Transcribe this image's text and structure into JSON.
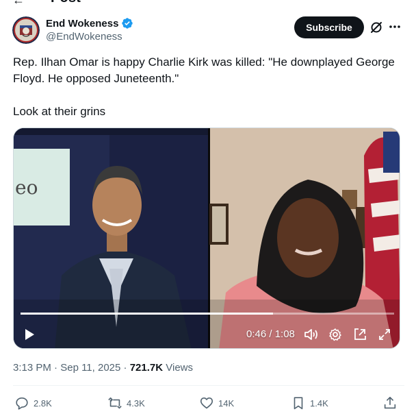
{
  "page": {
    "title": "Post"
  },
  "author": {
    "display_name": "End Wokeness",
    "handle": "@EndWokeness",
    "verified": true,
    "verified_color": "#1d9bf0"
  },
  "header": {
    "subscribe_label": "Subscribe"
  },
  "tweet": {
    "text_line1": "Rep. Ilhan Omar is happy Charlie Kirk was killed: \"He downplayed George Floyd. He opposed Juneteenth.\"",
    "text_line2": "Look at their grins"
  },
  "video": {
    "left_screen_text": "eo",
    "time_readout": "0:46 / 1:08",
    "progress_fraction": 0.676
  },
  "meta": {
    "time": "3:13 PM",
    "separator1": "·",
    "date": "Sep 11, 2025",
    "separator2": "·",
    "views_count": "721.7K",
    "views_label": "Views"
  },
  "actions": {
    "reply_count": "2.8K",
    "repost_count": "4.3K",
    "like_count": "14K",
    "bookmark_count": "1.4K"
  },
  "colors": {
    "text_primary": "#0f1419",
    "text_secondary": "#536471",
    "button_dark": "#0f1419"
  }
}
